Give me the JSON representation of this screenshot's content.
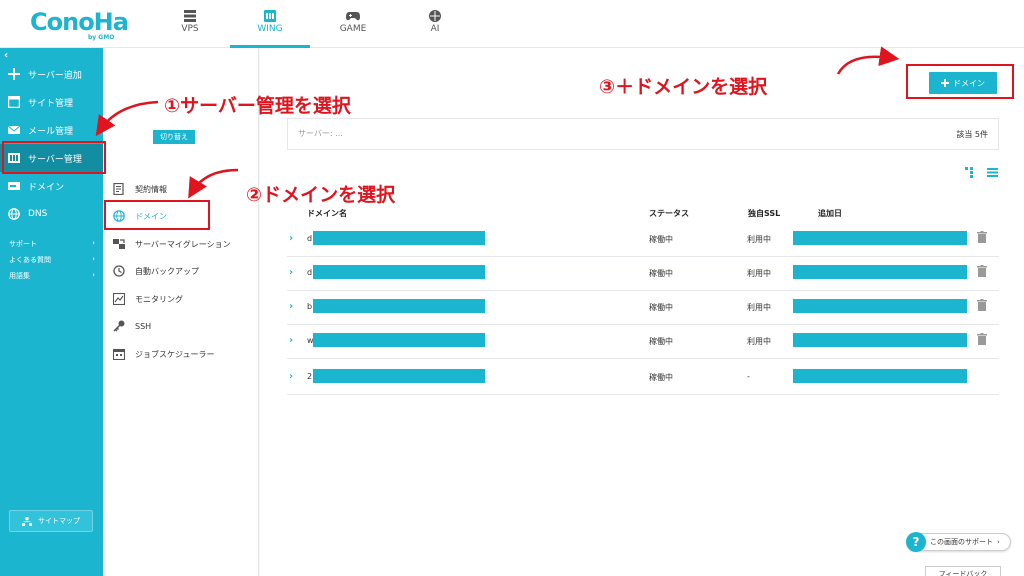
{
  "topbar": {
    "logo": "ConoHa",
    "logo_sub": "by GMO",
    "tabs": [
      {
        "label": "VPS",
        "icon": "server-icon"
      },
      {
        "label": "WING",
        "icon": "wing-icon"
      },
      {
        "label": "GAME",
        "icon": "gamepad-icon"
      },
      {
        "label": "AI",
        "icon": "ai-brain-icon"
      }
    ],
    "active_tab": "WING"
  },
  "sidebar": {
    "collapse": "‹",
    "items": [
      {
        "label": "サーバー追加",
        "icon": "plus-icon"
      },
      {
        "label": "サイト管理",
        "icon": "site-icon"
      },
      {
        "label": "メール管理",
        "icon": "mail-icon"
      },
      {
        "label": "サーバー管理",
        "icon": "server-manage-icon"
      },
      {
        "label": "ドメイン",
        "icon": "domain-icon"
      },
      {
        "label": "DNS",
        "icon": "globe-icon"
      }
    ],
    "links": [
      {
        "label": "サポート",
        "arrow": "›"
      },
      {
        "label": "よくある質問",
        "arrow": "›"
      },
      {
        "label": "用語集",
        "arrow": "›"
      }
    ],
    "sitemap": "サイトマップ"
  },
  "subnav": {
    "switch_button": "切り替え",
    "items": [
      {
        "label": "契約情報",
        "icon": "contract-icon"
      },
      {
        "label": "ドメイン",
        "icon": "globe-icon"
      },
      {
        "label": "サーバーマイグレーション",
        "icon": "migration-icon"
      },
      {
        "label": "自動バックアップ",
        "icon": "backup-icon"
      },
      {
        "label": "モニタリング",
        "icon": "monitoring-icon"
      },
      {
        "label": "SSH",
        "icon": "key-icon"
      },
      {
        "label": "ジョブスケジューラー",
        "icon": "scheduler-icon"
      }
    ]
  },
  "main": {
    "add_domain_label": "ドメイン",
    "filter_hint": "サーバー: ...",
    "count_label": "該当 5件",
    "table": {
      "headers": [
        "ドメイン名",
        "ステータス",
        "独自SSL",
        "追加日"
      ],
      "rows": [
        {
          "domain_initial": "d",
          "status": "稼働中",
          "ssl": "利用中"
        },
        {
          "domain_initial": "d",
          "status": "稼働中",
          "ssl": "利用中"
        },
        {
          "domain_initial": "b",
          "status": "稼働中",
          "ssl": "利用中"
        },
        {
          "domain_initial": "w",
          "status": "稼働中",
          "ssl": "利用中"
        },
        {
          "domain_initial": "2",
          "status": "稼働中",
          "ssl": "-"
        }
      ]
    },
    "support_button": "この画面のサポート",
    "support_arrow": "›",
    "bottom_button": "フィードバック"
  },
  "annotations": {
    "step1": "①サーバー管理を選択",
    "step2": "②ドメインを選択",
    "step3": "③＋ドメインを選択",
    "color": "#e0141e"
  },
  "colors": {
    "accent": "#1cb5cf",
    "sidebar_active": "#138da2"
  }
}
